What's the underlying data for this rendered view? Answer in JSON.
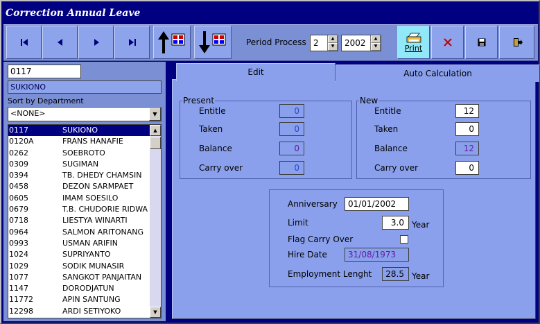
{
  "window": {
    "title": "Correction Annual Leave"
  },
  "toolbar": {
    "period_label": "Period Process",
    "period_month": "2",
    "period_year": "2002",
    "print_label": "Print"
  },
  "employee": {
    "code": "0117",
    "name": "SUKIONO"
  },
  "sort": {
    "label": "Sort by Department",
    "value": "<NONE>"
  },
  "employee_list": [
    {
      "code": "0117",
      "name": "SUKIONO"
    },
    {
      "code": "0120A",
      "name": "FRANS   HANAFIE"
    },
    {
      "code": "0262",
      "name": "SOEBROTO"
    },
    {
      "code": "0309",
      "name": "SUGIMAN"
    },
    {
      "code": "0394",
      "name": "TB. DHEDY CHAMSIN"
    },
    {
      "code": "0458",
      "name": "DEZON SARMPAET"
    },
    {
      "code": "0605",
      "name": "IMAM SOESILO"
    },
    {
      "code": "0679",
      "name": "T.B. CHUDORIE RIDWA"
    },
    {
      "code": "0718",
      "name": "LIESTYA WINARTI"
    },
    {
      "code": "0964",
      "name": "SALMON ARITONANG"
    },
    {
      "code": "0993",
      "name": "USMAN ARIFIN"
    },
    {
      "code": "1024",
      "name": "SUPRIYANTO"
    },
    {
      "code": "1029",
      "name": "SODIK MUNASIR"
    },
    {
      "code": "1077",
      "name": "SANGKOT PANJAITAN"
    },
    {
      "code": "1147",
      "name": "DORODJATUN"
    },
    {
      "code": "11772",
      "name": "APIN SANTUNG"
    },
    {
      "code": "12298",
      "name": "ARDI SETIYOKO"
    }
  ],
  "tabs": {
    "edit": "Edit",
    "auto": "Auto Calculation"
  },
  "present": {
    "legend": "Present",
    "entitle_label": "Entitle",
    "entitle": "0",
    "taken_label": "Taken",
    "taken": "0",
    "balance_label": "Balance",
    "balance": "0",
    "carry_label": "Carry over",
    "carry": "0"
  },
  "new": {
    "legend": "New",
    "entitle_label": "Entitle",
    "entitle": "12",
    "taken_label": "Taken",
    "taken": "0",
    "balance_label": "Balance",
    "balance": "12",
    "carry_label": "Carry over",
    "carry": "0"
  },
  "info": {
    "anniversary_label": "Anniversary",
    "anniversary": "01/01/2002",
    "limit_label": "Limit",
    "limit": "3.0",
    "limit_unit": "Year",
    "flag_label": "Flag Carry Over",
    "hire_label": "Hire Date",
    "hire": "31/08/1973",
    "emp_len_label": "Employment Lenght",
    "emp_len": "28.5",
    "emp_len_unit": "Year"
  }
}
